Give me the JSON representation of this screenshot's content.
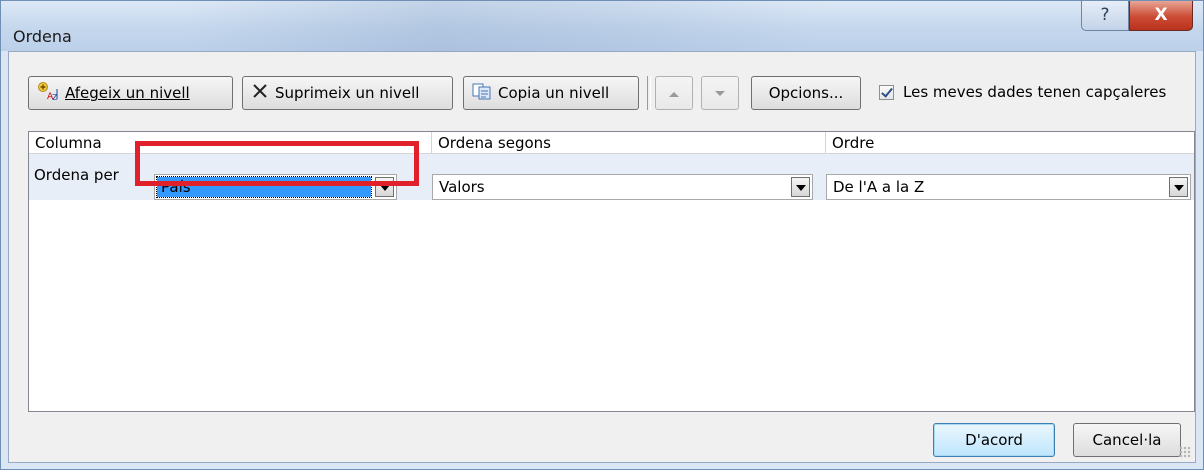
{
  "window": {
    "title": "Ordena",
    "help_label": "?",
    "close_label": "X"
  },
  "toolbar": {
    "add_level": "Afegeix un nivell",
    "delete_level": "Suprimeix un nivell",
    "copy_level": "Copia un nivell",
    "move_up_icon": "up-arrow",
    "move_down_icon": "down-arrow",
    "options": "Opcions...",
    "headers_checkbox": {
      "label": "Les meves dades tenen capçaleres",
      "checked": true
    }
  },
  "grid": {
    "headers": {
      "column": "Columna",
      "sort_on": "Ordena segons",
      "order": "Ordre"
    },
    "rows": [
      {
        "label": "Ordena per",
        "column": "País",
        "sort_on": "Valors",
        "order": "De l'A a la Z"
      }
    ]
  },
  "footer": {
    "ok": "D'acord",
    "cancel": "Cancel·la"
  },
  "colors": {
    "highlight": "#e0202a",
    "selection": "#3399ff",
    "close_button": "#cc4b34"
  }
}
